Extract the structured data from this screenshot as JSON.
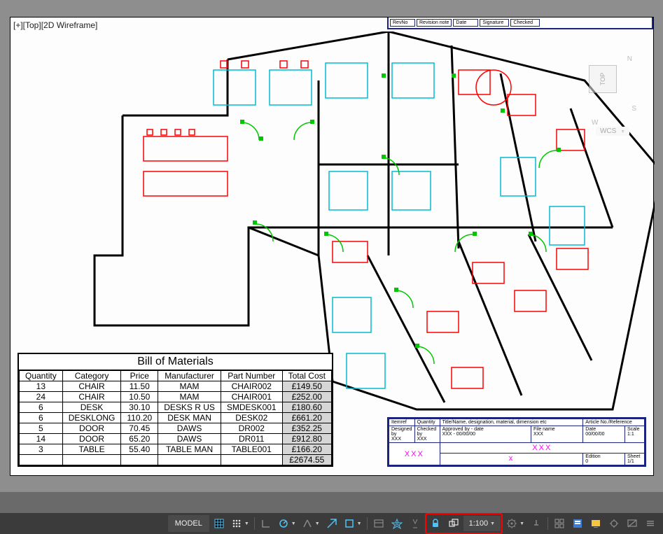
{
  "view": {
    "label": "[+][Top][2D Wireframe]"
  },
  "viewcube": {
    "face": "TOP",
    "n": "N",
    "s": "S",
    "w": "W",
    "wcs": "WCS"
  },
  "rev_block": {
    "headers": [
      "RevNo",
      "Revision note",
      "Date",
      "Signature",
      "Checked"
    ]
  },
  "title_block": {
    "row1": [
      "Itemref",
      "Quantity",
      "Title/Name, designation, material, dimension etc",
      "Article No./Reference"
    ],
    "designed_by": "Designed by",
    "designed_val": "XXX",
    "checked_by": "Checked by",
    "checked_val": "XXX",
    "approved_by": "Approved by - date",
    "approved_val": "XXX - 00/00/00",
    "file_name": "File name",
    "file_val": "XXX",
    "date": "Date",
    "date_val": "00/00/00",
    "scale": "Scale",
    "scale_val": "1:1",
    "big_xxx": "XXX",
    "bottom_x": "x",
    "edition": "Edition",
    "edition_val": "0",
    "sheet": "Sheet",
    "sheet_val": "1/1"
  },
  "bom": {
    "title": "Bill of Materials",
    "headers": [
      "Quantity",
      "Category",
      "Price",
      "Manufacturer",
      "Part Number",
      "Total Cost"
    ],
    "rows": [
      [
        "13",
        "CHAIR",
        "11.50",
        "MAM",
        "CHAIR002",
        "£149.50"
      ],
      [
        "24",
        "CHAIR",
        "10.50",
        "MAM",
        "CHAIR001",
        "£252.00"
      ],
      [
        "6",
        "DESK",
        "30.10",
        "DESKS R US",
        "SMDESK001",
        "£180.60"
      ],
      [
        "6",
        "DESKLONG",
        "110.20",
        "DESK MAN",
        "DESK02",
        "£661.20"
      ],
      [
        "5",
        "DOOR",
        "70.45",
        "DAWS",
        "DR002",
        "£352.25"
      ],
      [
        "14",
        "DOOR",
        "65.20",
        "DAWS",
        "DR011",
        "£912.80"
      ],
      [
        "3",
        "TABLE",
        "55.40",
        "TABLE MAN",
        "TABLE001",
        "£166.20"
      ]
    ],
    "total": "£2674.55"
  },
  "statusbar": {
    "model": "MODEL",
    "scale": "1:100"
  }
}
